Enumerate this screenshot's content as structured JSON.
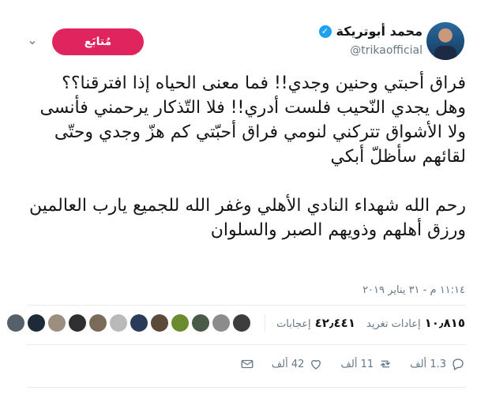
{
  "header": {
    "display_name": "محمد أبوتريكة",
    "verified_glyph": "✓",
    "handle": "@trikaofficial",
    "follow_label": "مُتابَع",
    "caret_glyph": "⌄"
  },
  "tweet": {
    "text": "فراق أحبتي وحنين وجدي!! فما معنى الحياه إذا افترقنا؟؟ وهل يجدي النّحيب فلست أدري!! فلا التّذكار يرحمني فأنسى ولا الأشواق تتركني لنومي فراق أحبّتي كم هزّ وجدي وحتّى لقائهم سأظلّ أبكي\n\nرحم الله شهداء النادي الأهلي وغفر الله للجميع يارب العالمين ورزق أهلهم وذويهم الصبر والسلوان",
    "timestamp": "١١:١٤ م - ٣١ يناير ٢٠١٩"
  },
  "stats": {
    "retweets_count": "١٠٫٨١٥",
    "retweets_label": "إعادات تغريد",
    "likes_count": "٤٢٫٤٤١",
    "likes_label": "إعجابات",
    "liker_colors": [
      "#3d3d3d",
      "#8c8c8c",
      "#4a5a48",
      "#6a8b2e",
      "#5b4a3a",
      "#2a3b5a",
      "#b9b9b9",
      "#7a6a5a",
      "#2f2f2f",
      "#9c8f80",
      "#1f2a38",
      "#55606b"
    ]
  },
  "actions": {
    "replies": "1.3 ألف",
    "retweets": "11 ألف",
    "likes": "42 ألف"
  },
  "icons": {
    "reply": "reply-icon",
    "retweet": "retweet-icon",
    "like": "heart-icon",
    "dm": "envelope-icon"
  }
}
